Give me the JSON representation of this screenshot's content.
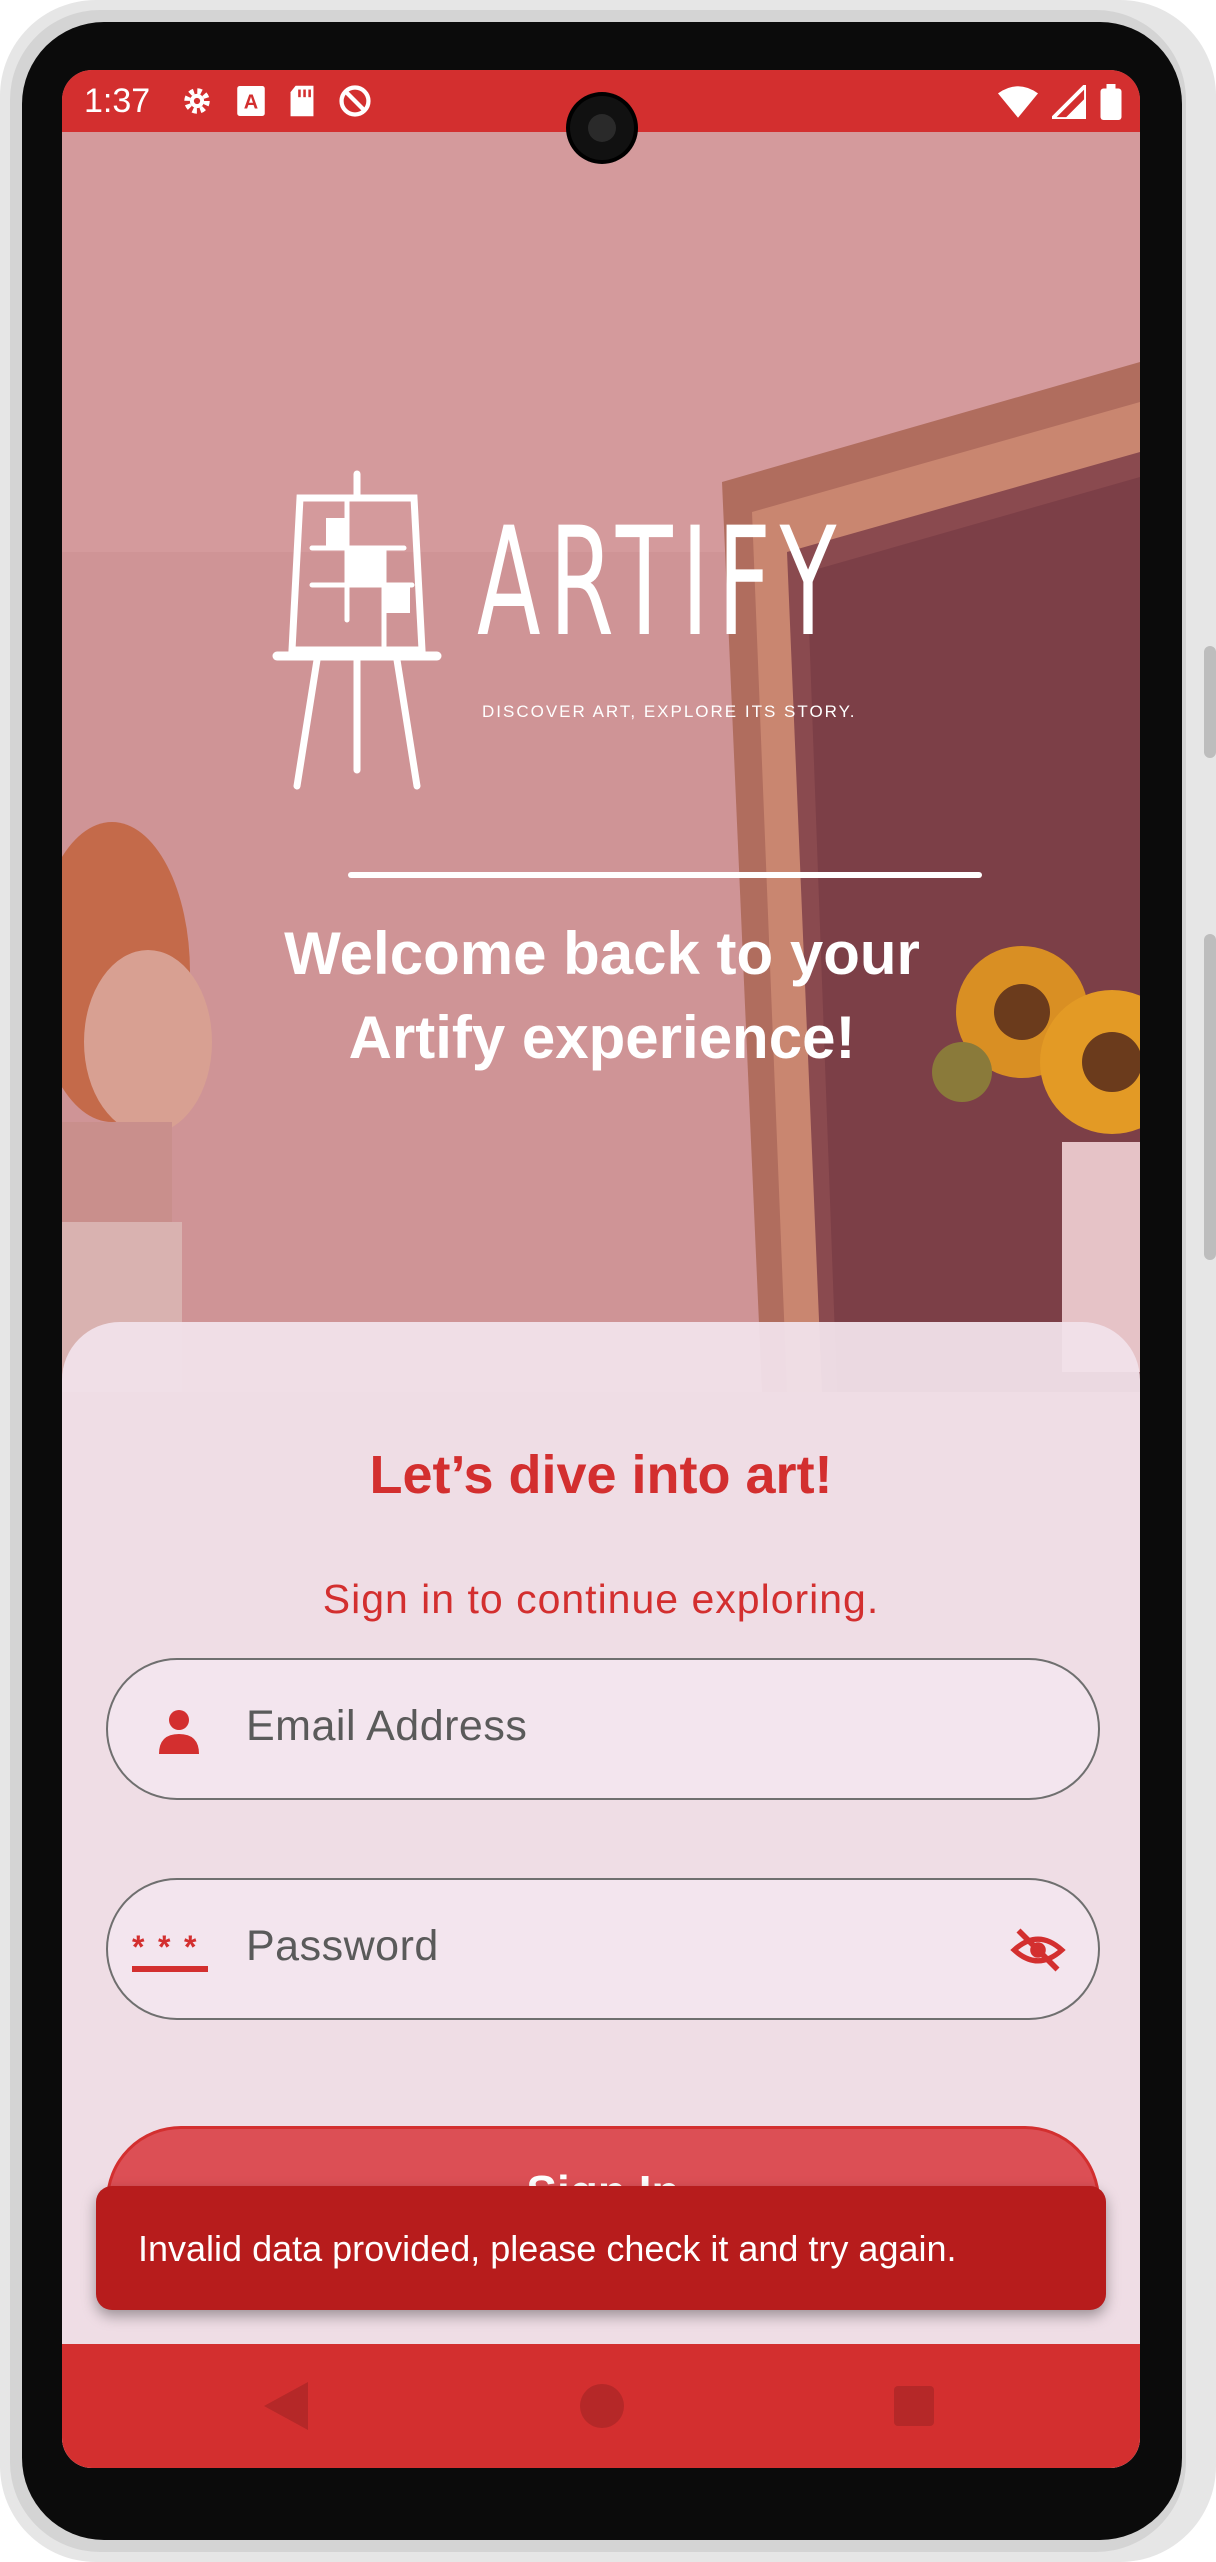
{
  "status_bar": {
    "time": "1:37",
    "icons_left": [
      "settings-icon",
      "keyboard-a-icon",
      "sd-card-icon",
      "do-not-disturb-icon"
    ],
    "icons_right": [
      "wifi-icon",
      "signal-icon",
      "battery-icon"
    ]
  },
  "hero": {
    "logo_word": "ARTIFY",
    "tagline": "DISCOVER ART, EXPLORE ITS STORY.",
    "welcome_line1": "Welcome back to your",
    "welcome_line2": "Artify experience!"
  },
  "form": {
    "title": "Let’s dive into art!",
    "subtitle": "Sign in to continue exploring.",
    "email_placeholder": "Email Address",
    "password_placeholder": "Password",
    "signin_label": "Sign In"
  },
  "snackbar": {
    "message": "Invalid data provided, please check it and try again."
  },
  "nav_bar": {
    "icons": [
      "back-icon",
      "home-icon",
      "recents-icon"
    ]
  },
  "colors": {
    "primary": "#d32f2f",
    "primary_dark": "#b71c1c",
    "card_bg": "#f1e2ea",
    "hero_tint": "#cf9496"
  }
}
